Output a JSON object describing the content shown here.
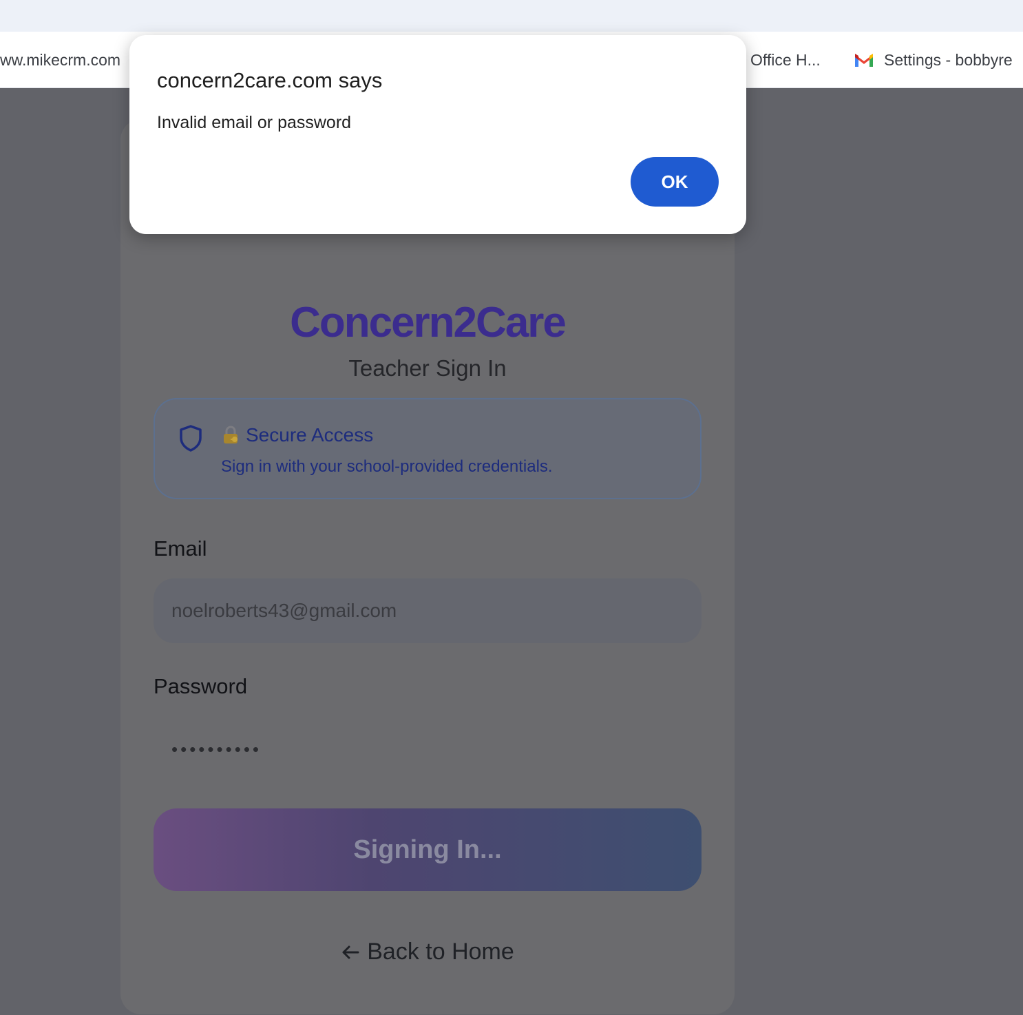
{
  "browser": {
    "bookmarks": [
      {
        "label": "ww.mikecrm.com"
      },
      {
        "label": "Office H..."
      },
      {
        "label": "Settings - bobbyre",
        "icon": "gmail-icon"
      }
    ]
  },
  "page": {
    "logo": "Concern2Care",
    "subtitle": "Teacher Sign In",
    "secure": {
      "title": "Secure Access",
      "description": "Sign in with your school-provided credentials."
    },
    "email": {
      "label": "Email",
      "value": "noelroberts43@gmail.com"
    },
    "password": {
      "label": "Password",
      "value": "••••••••••"
    },
    "submit_label": "Signing In...",
    "back_label": "Back to Home",
    "colors": {
      "logo": "#3b2c8e",
      "secure_text": "#1d2c7d"
    }
  },
  "dialog": {
    "title": "concern2care.com says",
    "message": "Invalid email or password",
    "ok_label": "OK",
    "ok_color": "#1f5bd1"
  }
}
